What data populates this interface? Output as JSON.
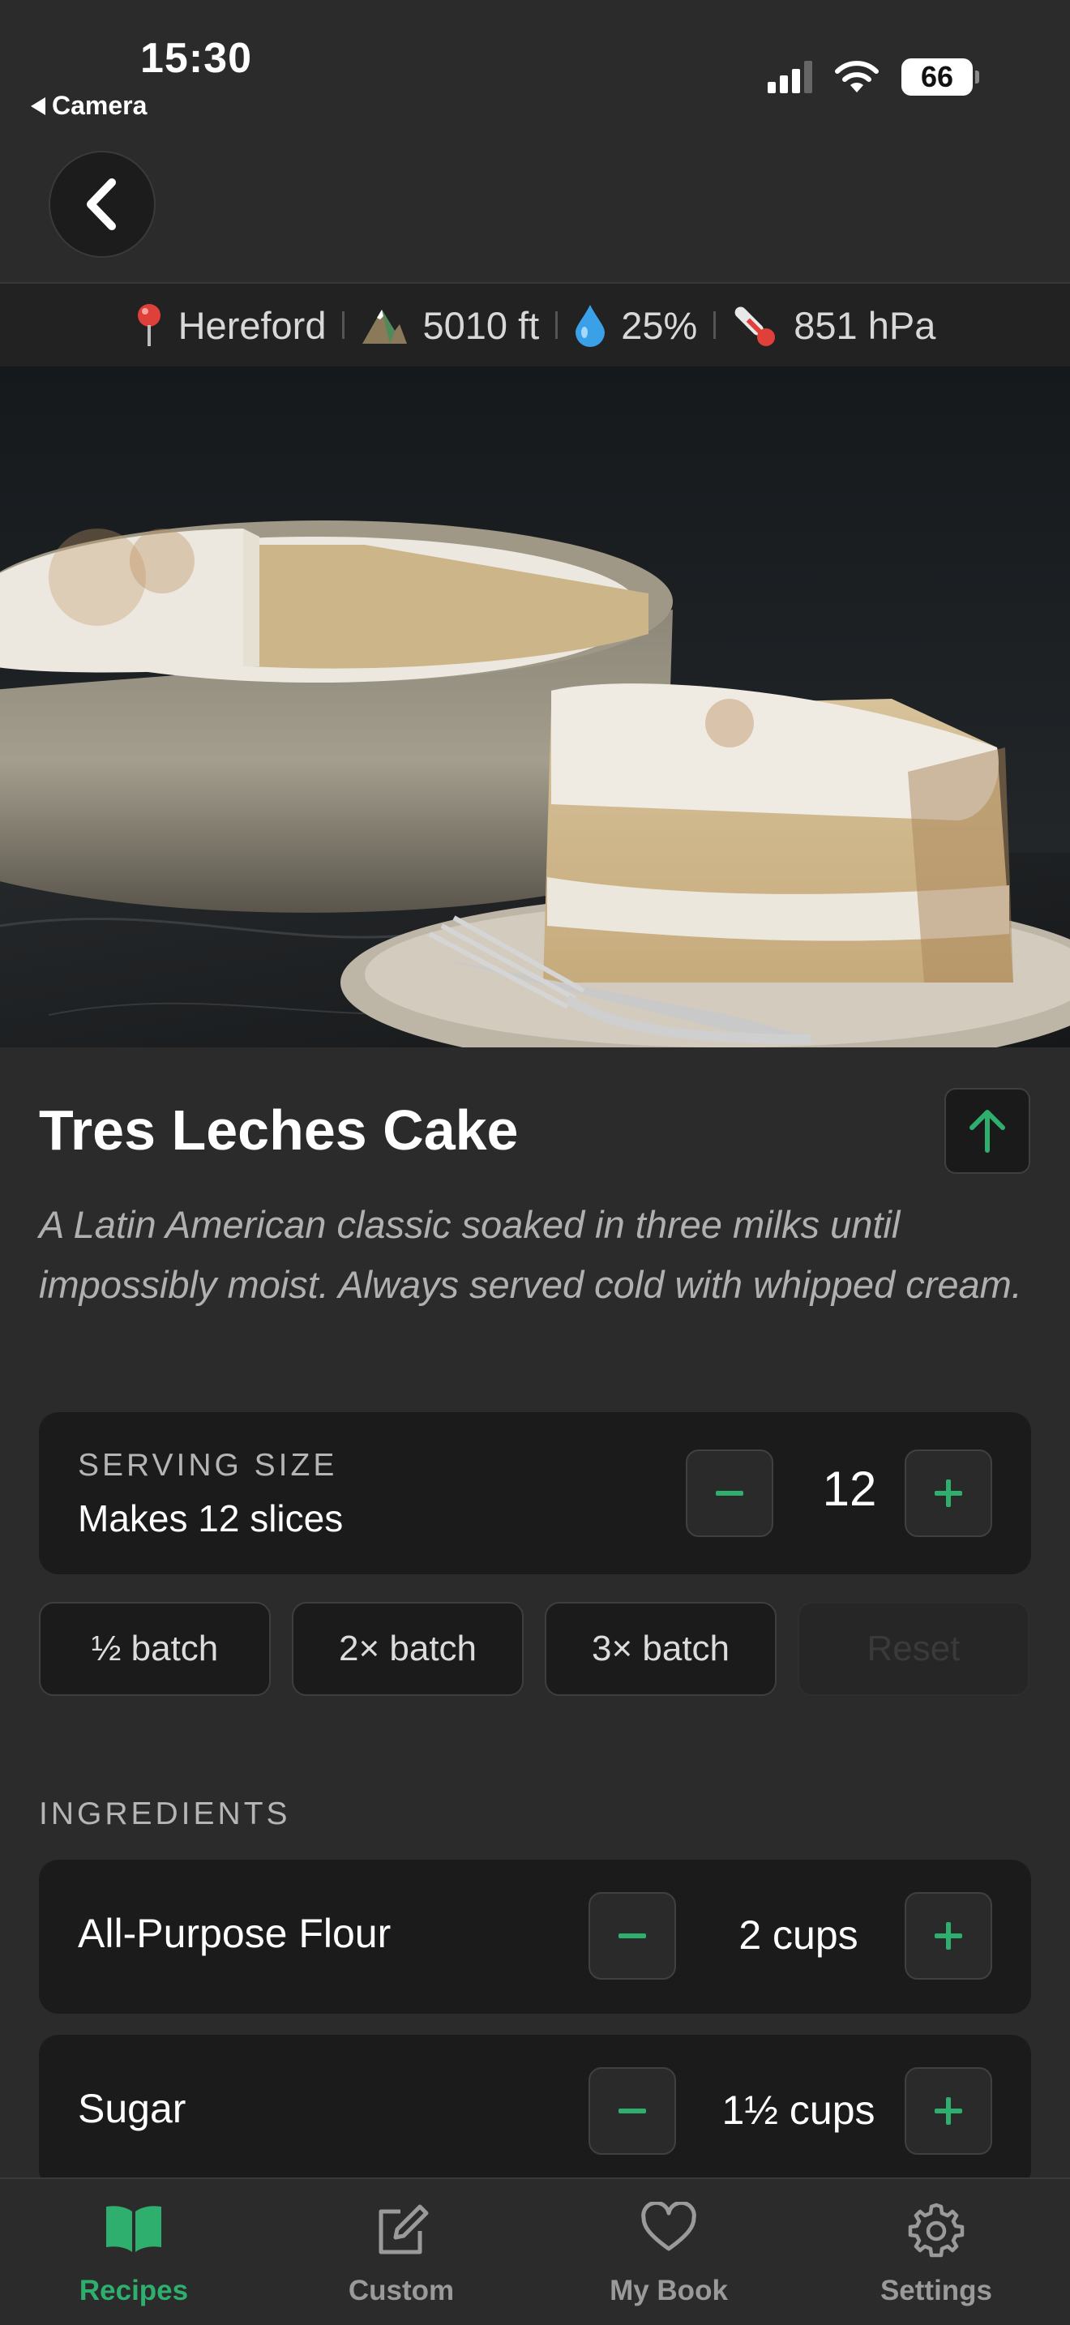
{
  "status_bar": {
    "time": "15:30",
    "back_app": "Camera",
    "battery": "66"
  },
  "environment": {
    "location": "Hereford",
    "altitude": "5010 ft",
    "humidity": "25%",
    "pressure": "851 hPa"
  },
  "recipe": {
    "title": "Tres Leches Cake",
    "description": "A Latin American classic soaked in three milks until impossibly moist. Always served cold with whipped cream."
  },
  "serving": {
    "label": "SERVING SIZE",
    "subtitle": "Makes 12 slices",
    "value": "12"
  },
  "batch_buttons": [
    {
      "label": "½ batch"
    },
    {
      "label": "2× batch"
    },
    {
      "label": "3× batch"
    },
    {
      "label": "Reset"
    }
  ],
  "ingredients": {
    "header": "INGREDIENTS",
    "items": [
      {
        "name": "All-Purpose Flour",
        "qty": "2 cups"
      },
      {
        "name": "Sugar",
        "qty": "1½ cups"
      }
    ]
  },
  "tabs": [
    {
      "label": "Recipes",
      "icon": "book-icon",
      "active": true
    },
    {
      "label": "Custom",
      "icon": "edit-icon",
      "active": false
    },
    {
      "label": "My Book",
      "icon": "heart-icon",
      "active": false
    },
    {
      "label": "Settings",
      "icon": "gear-icon",
      "active": false
    }
  ],
  "colors": {
    "accent": "#2faf6e",
    "background": "#2b2b2b",
    "card": "#1b1b1b"
  }
}
